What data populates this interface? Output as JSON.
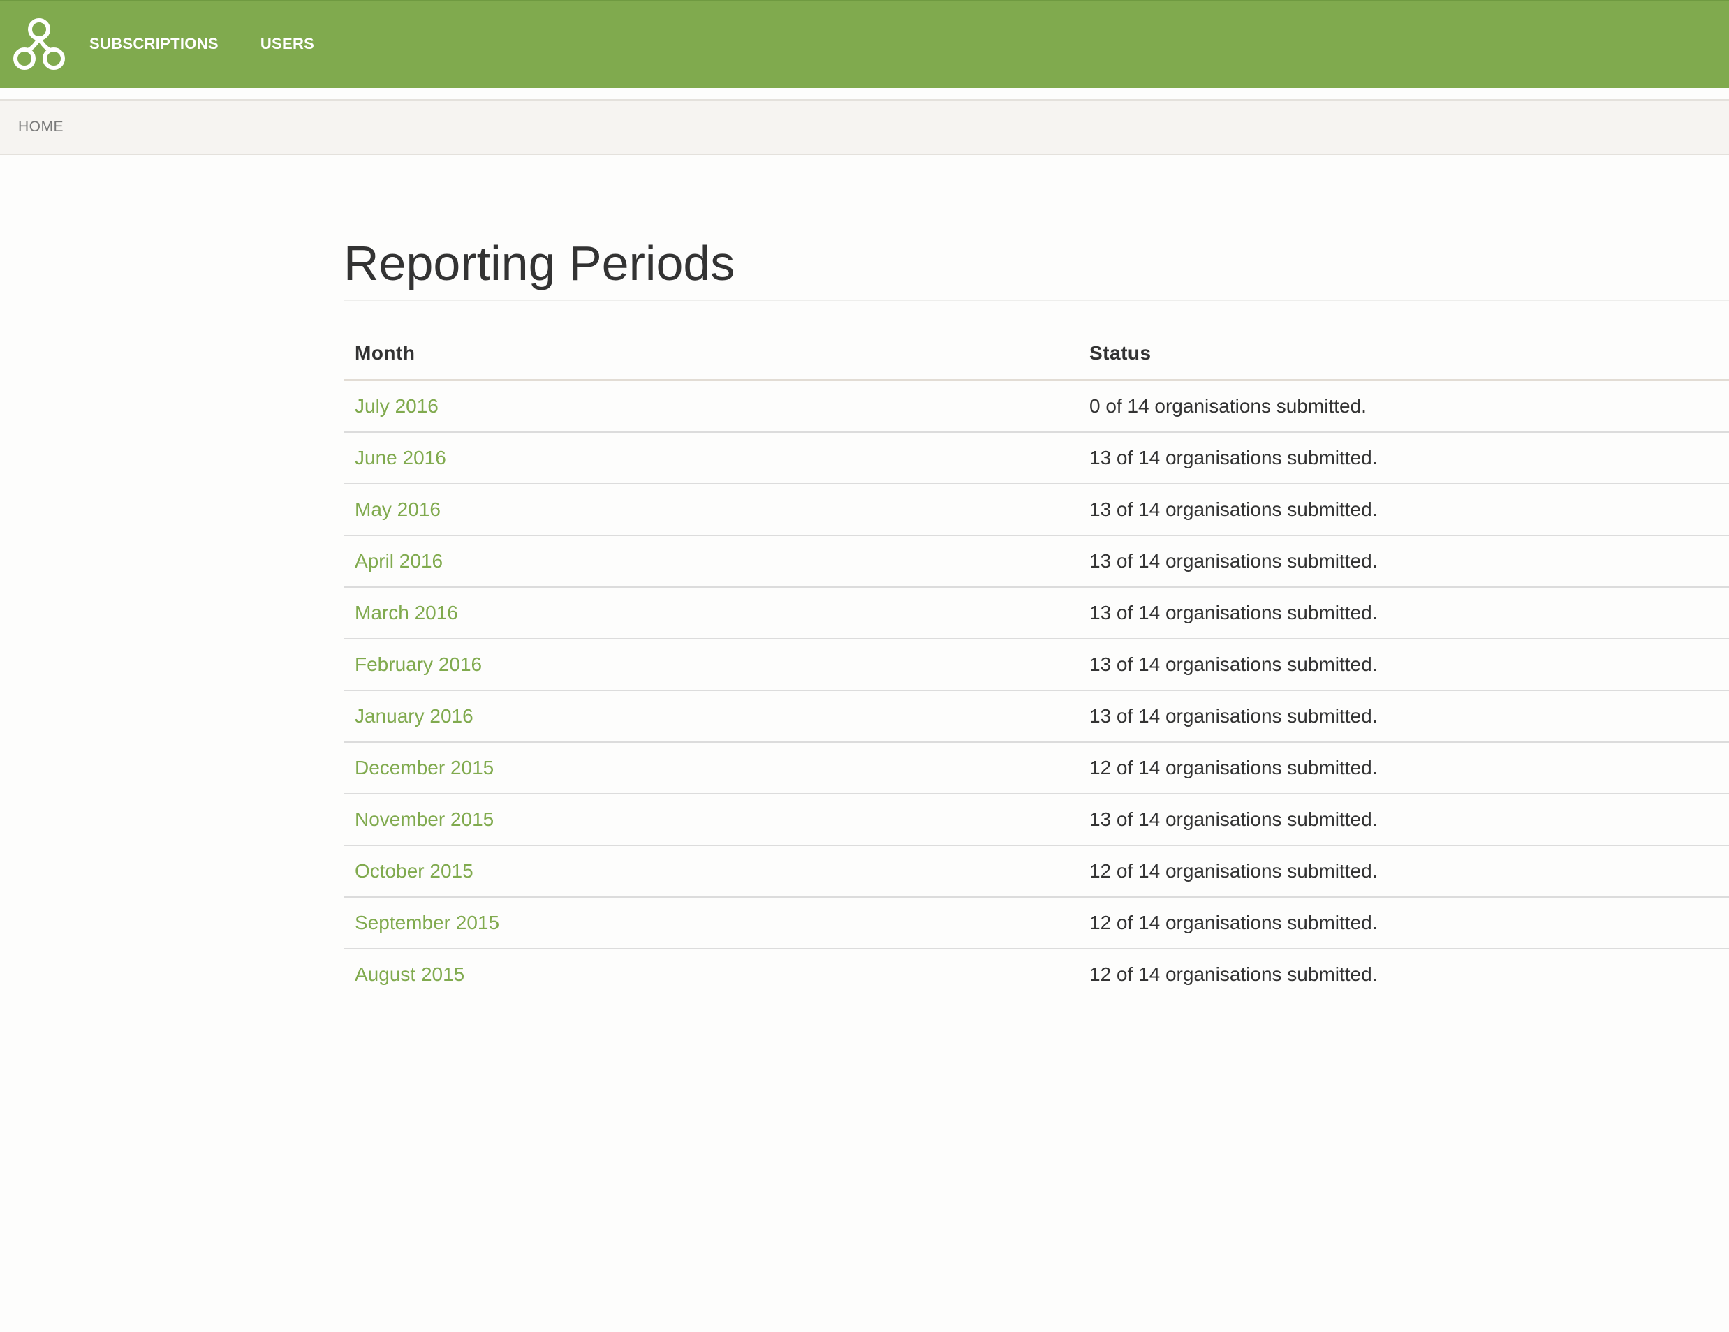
{
  "colors": {
    "brand": "#80aa4e",
    "breadcrumb_bg": "#f6f4f1",
    "text": "#333333",
    "link": "#80aa4e"
  },
  "header": {
    "logo_icon": "three-circles-logo-icon",
    "nav": [
      {
        "label": "SUBSCRIPTIONS"
      },
      {
        "label": "USERS"
      }
    ]
  },
  "breadcrumb": {
    "items": [
      {
        "label": "HOME"
      }
    ]
  },
  "main": {
    "title": "Reporting Periods",
    "table": {
      "columns": [
        "Month",
        "Status"
      ],
      "rows": [
        {
          "month": "July 2016",
          "status": "0 of 14 organisations submitted."
        },
        {
          "month": "June 2016",
          "status": "13 of 14 organisations submitted."
        },
        {
          "month": "May 2016",
          "status": "13 of 14 organisations submitted."
        },
        {
          "month": "April 2016",
          "status": "13 of 14 organisations submitted."
        },
        {
          "month": "March 2016",
          "status": "13 of 14 organisations submitted."
        },
        {
          "month": "February 2016",
          "status": "13 of 14 organisations submitted."
        },
        {
          "month": "January 2016",
          "status": "13 of 14 organisations submitted."
        },
        {
          "month": "December 2015",
          "status": "12 of 14 organisations submitted."
        },
        {
          "month": "November 2015",
          "status": "13 of 14 organisations submitted."
        },
        {
          "month": "October 2015",
          "status": "12 of 14 organisations submitted."
        },
        {
          "month": "September 2015",
          "status": "12 of 14 organisations submitted."
        },
        {
          "month": "August 2015",
          "status": "12 of 14 organisations submitted."
        }
      ]
    }
  }
}
